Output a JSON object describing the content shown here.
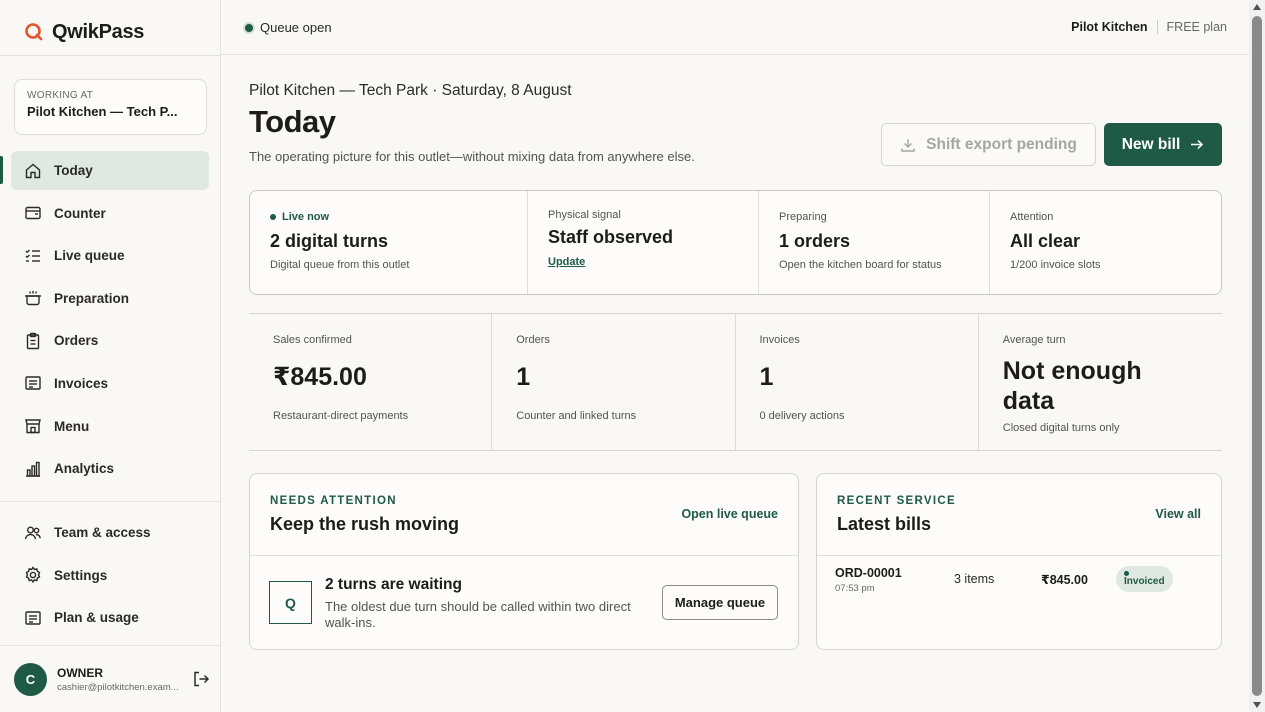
{
  "brand": {
    "name": "QwikPass",
    "accent": "#e0572d"
  },
  "workspace": {
    "label": "WORKING AT",
    "name": "Pilot Kitchen — Tech P..."
  },
  "nav": [
    {
      "label": "Today",
      "icon": "home-icon",
      "active": true
    },
    {
      "label": "Counter",
      "icon": "counter-icon"
    },
    {
      "label": "Live queue",
      "icon": "list-icon"
    },
    {
      "label": "Preparation",
      "icon": "pot-icon"
    },
    {
      "label": "Orders",
      "icon": "clipboard-icon"
    },
    {
      "label": "Invoices",
      "icon": "receipt-icon"
    },
    {
      "label": "Menu",
      "icon": "store-icon"
    },
    {
      "label": "Analytics",
      "icon": "bar-chart-icon"
    }
  ],
  "nav_secondary": [
    {
      "label": "Team & access",
      "icon": "team-icon"
    },
    {
      "label": "Settings",
      "icon": "gear-icon"
    },
    {
      "label": "Plan & usage",
      "icon": "plan-icon"
    }
  ],
  "user": {
    "initial": "C",
    "role": "OWNER",
    "email": "cashier@pilotkitchen.exam..."
  },
  "topbar": {
    "queue_status": "Queue open",
    "outlet": "Pilot Kitchen",
    "plan": "FREE plan"
  },
  "header": {
    "breadcrumb": "Pilot Kitchen — Tech Park · Saturday, 8 August",
    "title": "Today",
    "subtitle": "The operating picture for this outlet—without mixing data from anywhere else.",
    "export_label": "Shift export pending",
    "new_bill_label": "New bill"
  },
  "status": {
    "live": {
      "label": "Live now",
      "value": "2 digital turns",
      "note": "Digital queue from this outlet"
    },
    "signal": {
      "label": "Physical signal",
      "value": "Staff observed",
      "link": "Update"
    },
    "preparing": {
      "label": "Preparing",
      "value": "1 orders",
      "note": "Open the kitchen board for status"
    },
    "attention": {
      "label": "Attention",
      "value": "All clear",
      "note": "1/200 invoice slots"
    }
  },
  "metrics": [
    {
      "label": "Sales confirmed",
      "value": "₹845.00",
      "note": "Restaurant-direct payments"
    },
    {
      "label": "Orders",
      "value": "1",
      "note": "Counter and linked turns"
    },
    {
      "label": "Invoices",
      "value": "1",
      "note": "0 delivery actions"
    },
    {
      "label": "Average turn",
      "value": "Not enough data",
      "note": "Closed digital turns only"
    }
  ],
  "attention_card": {
    "eyebrow": "NEEDS ATTENTION",
    "heading": "Keep the rush moving",
    "link": "Open live queue",
    "badge": "Q",
    "title": "2 turns are waiting",
    "description": "The oldest due turn should be called within two direct walk-ins.",
    "button": "Manage queue"
  },
  "recent_card": {
    "eyebrow": "RECENT SERVICE",
    "heading": "Latest bills",
    "link": "View all",
    "bills": [
      {
        "id": "ORD-00001",
        "time": "07:53 pm",
        "items": "3 items",
        "amount": "₹845.00",
        "status": "Invoiced"
      }
    ]
  }
}
